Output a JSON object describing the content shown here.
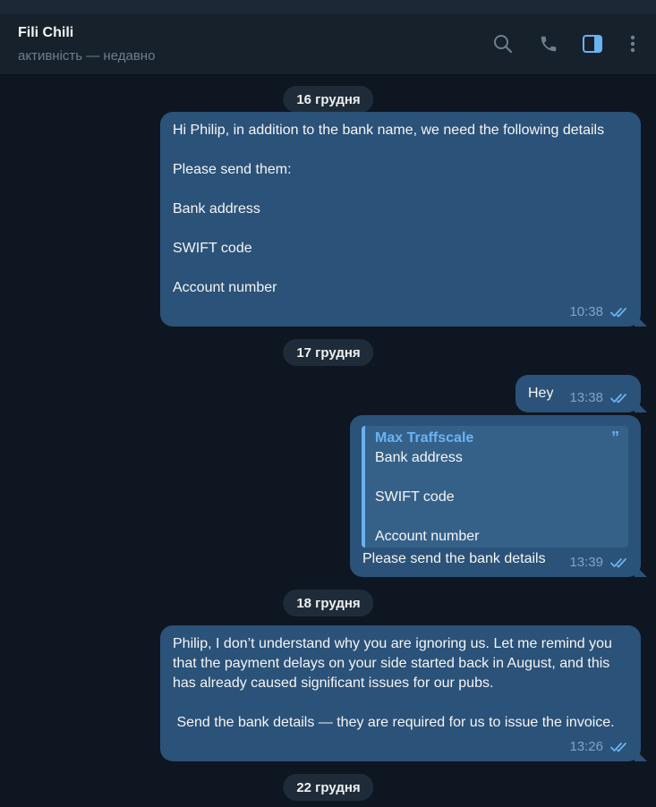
{
  "header": {
    "title": "Fili Chili",
    "status": "активність — недавно",
    "icons": [
      "search-icon",
      "phone-icon",
      "sidebar-toggle-icon",
      "more-icon"
    ]
  },
  "colors": {
    "background": "#0e1621",
    "header": "#17212b",
    "outgoing_bubble": "#2b5278",
    "accent": "#6ab3f3",
    "meta": "#7ea4c9",
    "date_pill": "#1e2c3a"
  },
  "messages": {
    "date1": "16 грудня",
    "msg1": {
      "text": "Hi Philip, in addition to the bank name, we need the following details\n\nPlease send them:\n\nBank address\n\nSWIFT code\n\nAccount number",
      "time": "10:38"
    },
    "date2": "17 грудня",
    "msg2": {
      "text": "Hey",
      "time": "13:38"
    },
    "msg3": {
      "quote_author": "Max Traffscale",
      "quote_text": "Bank address\n\nSWIFT code\n\nAccount number",
      "quote_mark": "”",
      "text": "Please send the bank details",
      "time": "13:39"
    },
    "date3": "18 грудня",
    "msg4": {
      "text": "Philip, I don’t understand why you are ignoring us. Let me remind you that the payment delays on your side started back in August, and this has already caused significant issues for our pubs.\n\n Send the bank details — they are required for us to issue the invoice.",
      "time": "13:26"
    },
    "date4": "22 грудня"
  }
}
